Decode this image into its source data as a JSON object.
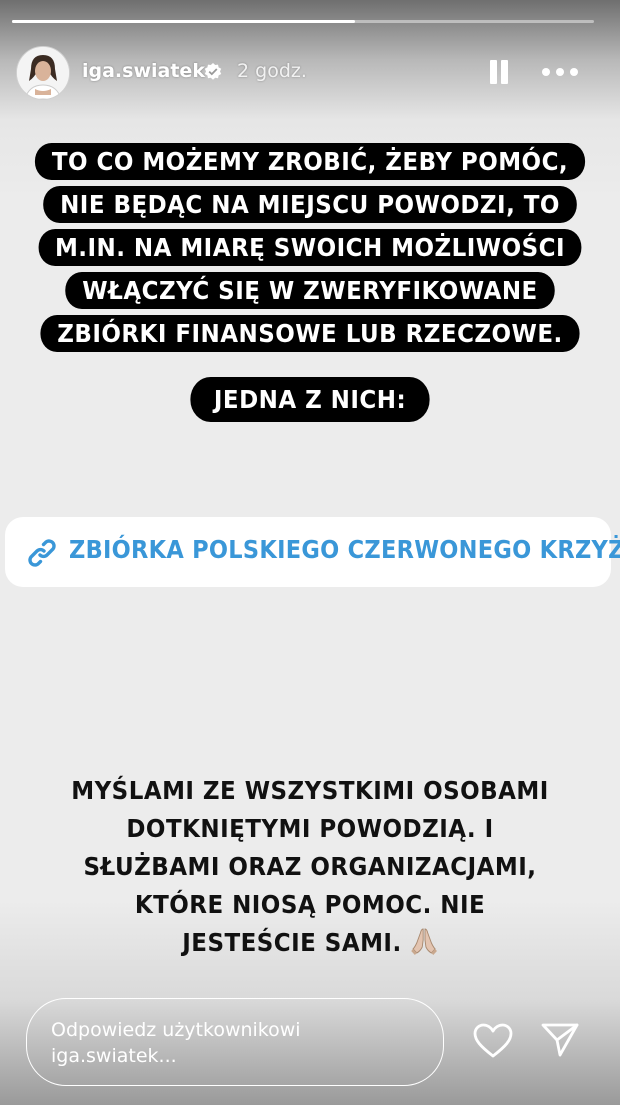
{
  "progress": {
    "fraction": 0.59
  },
  "header": {
    "username": "iga.swiatek",
    "timestamp": "2 godz."
  },
  "story": {
    "text_block_1_lines": [
      "TO CO MOŻEMY ZROBIĆ, ŻEBY POMÓC,",
      "NIE BĘDĄC NA MIEJSCU POWODZI, TO",
      "M.IN. NA MIARĘ SWOICH MOŻLIWOŚCI",
      "WŁĄCZYĆ SIĘ W ZWERYFIKOWANE",
      "ZBIÓRKI FINANSOWE LUB RZECZOWE."
    ],
    "text_block_2": "JEDNA Z NICH:",
    "link_sticker_label": "ZBIÓRKA POLSKIEGO CZERWONEGO KRZYŻA",
    "text_block_3_lines": [
      "MYŚLAMI ZE WSZYSTKIMI OSOBAMI",
      "DOTKNIĘTYMI POWODZIĄ. I",
      "SŁUŻBAMI ORAZ ORGANIZACJAMI,",
      "KTÓRE NIOSĄ POMOC. NIE",
      "JESTEŚCIE SAMI."
    ]
  },
  "reply": {
    "placeholder_line_1": "Odpowiedz użytkownikowi",
    "placeholder_line_2": "iga.swiatek..."
  },
  "colors": {
    "link_text": "#3a97d8",
    "highlight_bg": "#000000",
    "verified_badge": "#ffffff"
  },
  "icons": [
    "verified-badge-icon",
    "pause-icon",
    "more-icon",
    "link-icon",
    "prayer-hands-emoji",
    "heart-icon",
    "send-icon"
  ]
}
